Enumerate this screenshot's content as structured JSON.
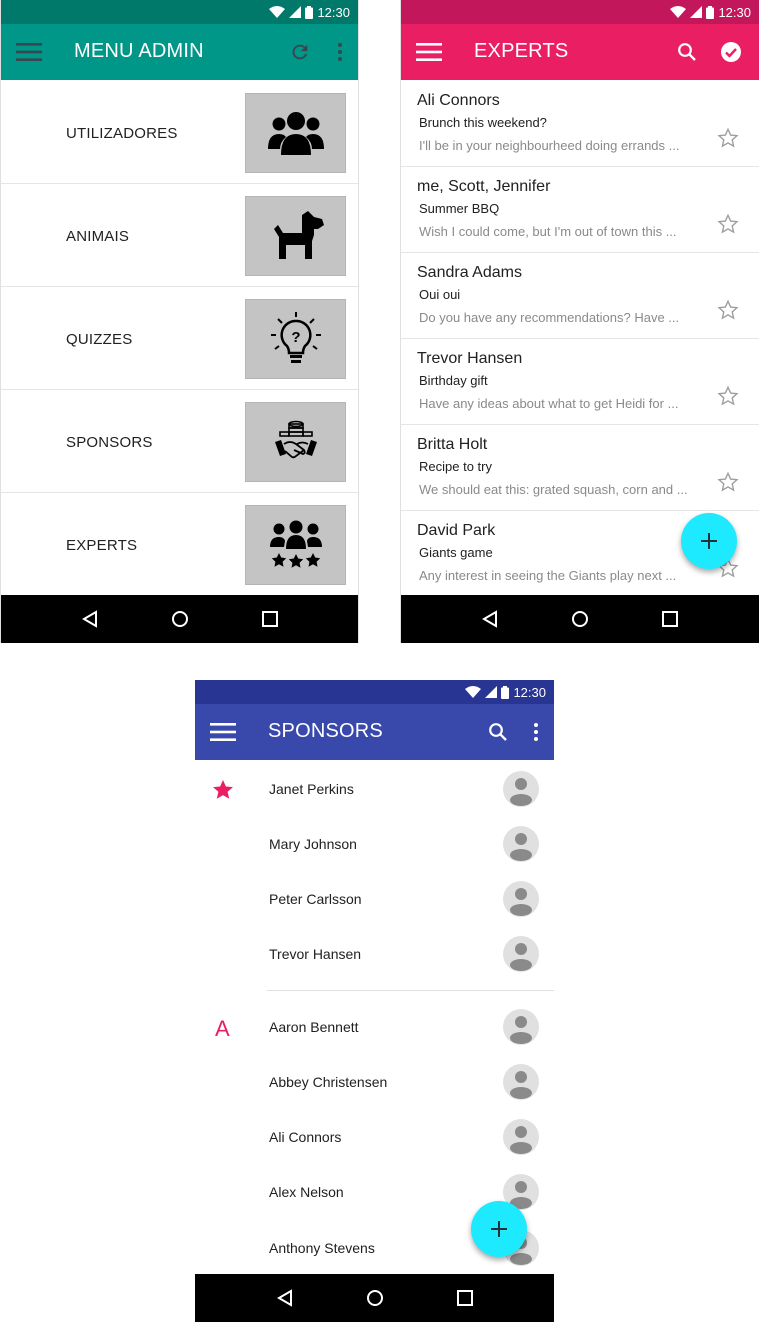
{
  "status": {
    "time": "12:30"
  },
  "admin": {
    "title": "MENU ADMIN",
    "items": [
      {
        "label": "UTILIZADORES",
        "icon": "users-group-icon"
      },
      {
        "label": "ANIMAIS",
        "icon": "dog-icon"
      },
      {
        "label": "QUIZZES",
        "icon": "lightbulb-question-icon"
      },
      {
        "label": "SPONSORS",
        "icon": "coins-handshake-icon"
      },
      {
        "label": "EXPERTS",
        "icon": "experts-stars-icon"
      }
    ]
  },
  "experts": {
    "title": "EXPERTS",
    "emails": [
      {
        "from": "Ali Connors",
        "subject": "Brunch this weekend?",
        "preview": "I'll be in your neighbourheed doing errands ..."
      },
      {
        "from": "me, Scott, Jennifer",
        "subject": "Summer BBQ",
        "preview": "Wish I could come, but I'm out of town this ..."
      },
      {
        "from": "Sandra Adams",
        "subject": "Oui oui",
        "preview": "Do you have any recommendations? Have ..."
      },
      {
        "from": "Trevor Hansen",
        "subject": "Birthday gift",
        "preview": "Have any ideas about what to get Heidi for ..."
      },
      {
        "from": "Britta Holt",
        "subject": "Recipe to try",
        "preview": "We should eat this: grated squash, corn and ..."
      },
      {
        "from": "David Park",
        "subject": "Giants game",
        "preview": "Any interest in seeing the Giants play next ..."
      }
    ]
  },
  "sponsors": {
    "title": "SPONSORS",
    "favorites": [
      "Janet Perkins",
      "Mary Johnson",
      "Peter Carlsson",
      "Trevor Hansen"
    ],
    "section_letter": "A",
    "contacts": [
      "Aaron Bennett",
      "Abbey Christensen",
      "Ali Connors",
      "Alex Nelson",
      "Anthony Stevens"
    ]
  },
  "colors": {
    "teal": "#009688",
    "teal_dark": "#00796b",
    "pink": "#e91e63",
    "pink_dark": "#c2185b",
    "indigo": "#3949ab",
    "indigo_dark": "#283593",
    "fab": "#1de9ff"
  }
}
